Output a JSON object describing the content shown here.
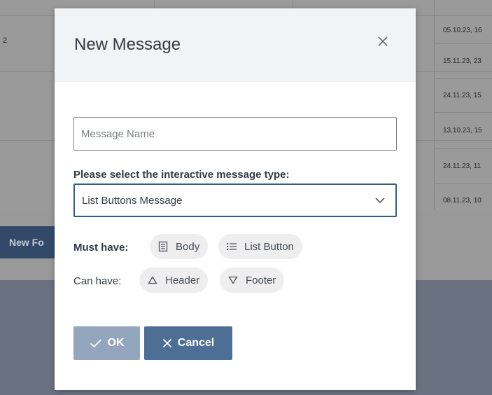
{
  "background": {
    "left_number": "2",
    "dates": [
      "05.10.23, 16",
      "15.11.23, 23",
      "24.11.23, 15",
      "13.10.23, 15",
      "24.11.23, 11",
      "08.11.23, 10"
    ],
    "new_form_label": "New Fo"
  },
  "modal": {
    "title": "New Message",
    "close_icon": "close-icon",
    "name_input": {
      "value": "",
      "placeholder": "Message Name"
    },
    "type_label": "Please select the interactive message type:",
    "type_select": {
      "value": "List Buttons Message",
      "icon": "chevron-down-icon"
    },
    "must_have": {
      "label": "Must have:",
      "chips": [
        {
          "label": "Body",
          "icon": "document-icon"
        },
        {
          "label": "List Button",
          "icon": "list-icon"
        }
      ]
    },
    "can_have": {
      "label": "Can have:",
      "chips": [
        {
          "label": "Header",
          "icon": "triangle-up-icon"
        },
        {
          "label": "Footer",
          "icon": "triangle-down-icon"
        }
      ]
    },
    "ok_button": {
      "label": "OK",
      "icon": "check-icon"
    },
    "cancel_button": {
      "label": "Cancel",
      "icon": "close-icon"
    }
  },
  "colors": {
    "primary": "#4e6f95",
    "primary_disabled": "#94a6bd",
    "select_border": "#2f5e8e",
    "chip_bg": "#eeeeee",
    "header_bg": "#f2f3f5"
  }
}
